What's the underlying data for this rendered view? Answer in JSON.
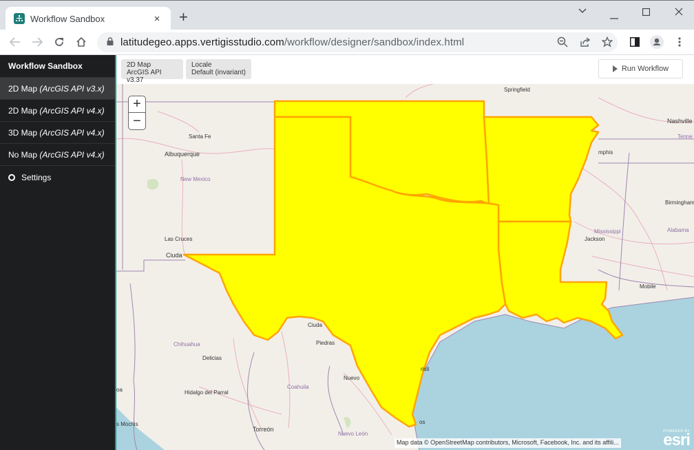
{
  "browser": {
    "tab_title": "Workflow Sandbox",
    "url_host": "latitudegeo.apps.vertigisstudio.com",
    "url_path": "/workflow/designer/sandbox/index.html",
    "new_tab_symbol": "+",
    "tab_close_symbol": "×",
    "icons": [
      "back-icon",
      "forward-icon",
      "reload-icon",
      "home-icon",
      "lock-icon",
      "zoom-out-icon",
      "share-icon",
      "bookmark-star-icon",
      "side-panel-icon",
      "profile-icon",
      "menu-kebab-icon"
    ]
  },
  "sidebar": {
    "title": "Workflow Sandbox",
    "items": [
      {
        "prefix": "2D Map ",
        "api": "(ArcGIS API v3.x)",
        "active": true
      },
      {
        "prefix": "2D Map ",
        "api": "(ArcGIS API v4.x)",
        "active": false
      },
      {
        "prefix": "3D Map ",
        "api": "(ArcGIS API v4.x)",
        "active": false
      },
      {
        "prefix": "No Map ",
        "api": "(ArcGIS API v4.x)",
        "active": false
      }
    ],
    "settings_label": "Settings"
  },
  "header": {
    "chips": [
      {
        "line1": "2D Map",
        "line2": "ArcGIS API v3.37"
      },
      {
        "line1": "Locale",
        "line2": "Default (invariant)"
      }
    ],
    "run_label": "Run Workflow"
  },
  "map": {
    "zoom_in": "+",
    "zoom_out": "−",
    "highlight_fill": "#ffff00",
    "highlight_stroke": "#ffa500",
    "highlighted_states": [
      "Texas",
      "Oklahoma",
      "Arkansas",
      "Louisiana"
    ],
    "labels": {
      "springfield": "Springfield",
      "nashville": "Nashville",
      "tenne": "Tenne",
      "memphis": "mphis",
      "santa_fe": "Santa Fe",
      "albuquerque": "Albuquerque",
      "new_mexico": "New Mexico",
      "las_cruces": "Las Cruces",
      "ciudad_juarez": "Ciuda",
      "birmingham": "Birmingham",
      "mississippi": "Mississippi",
      "jackson": "Jackson",
      "alabama": "Alabama",
      "mobile": "Mobile",
      "chihuahua": "Chihuahua",
      "delicias": "Delicias",
      "hidalgo": "Hidalgo del Parral",
      "coahuila": "Coahuila",
      "ciudad_acuna": "Ciuda",
      "piedras": "Piedras",
      "nuevo": "Nuevo",
      "nuevo_leon": "Nuevo León",
      "torreon": "Torreón",
      "los_mochis": "s Mochis",
      "sinaloa": "oa",
      "corpus": "risti",
      "matamoros": "os"
    },
    "attribution": "Map data © OpenStreetMap contributors, Microsoft, Facebook, Inc. and its affili...",
    "esri_powered": "POWERED BY",
    "esri_logo": "esri"
  }
}
